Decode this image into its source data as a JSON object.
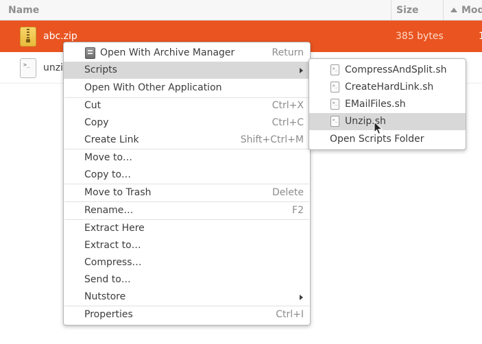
{
  "columns": {
    "name": "Name",
    "size": "Size",
    "modified": "Mod"
  },
  "files": [
    {
      "name": "abc.zip",
      "size": "385 bytes",
      "modified_partial": "1",
      "icon": "zip-archive-icon",
      "selected": true
    },
    {
      "name": "unzip",
      "size": "",
      "icon": "shell-script-icon",
      "selected": false
    }
  ],
  "context_menu": {
    "items": [
      {
        "label": "Open With Archive Manager",
        "accel": "Return",
        "icon": "archive-manager-icon"
      },
      {
        "label": "Scripts",
        "accel": "",
        "submenu": true,
        "highlighted": true
      },
      {
        "label": "Open With Other Application",
        "accel": ""
      },
      {
        "label": "Cut",
        "accel": "Ctrl+X"
      },
      {
        "label": "Copy",
        "accel": "Ctrl+C"
      },
      {
        "label": "Create Link",
        "accel": "Shift+Ctrl+M"
      },
      {
        "label": "Move to…",
        "accel": ""
      },
      {
        "label": "Copy to…",
        "accel": ""
      },
      {
        "label": "Move to Trash",
        "accel": "Delete"
      },
      {
        "label": "Rename…",
        "accel": "F2"
      },
      {
        "label": "Extract Here",
        "accel": ""
      },
      {
        "label": "Extract to…",
        "accel": ""
      },
      {
        "label": "Compress…",
        "accel": ""
      },
      {
        "label": "Send to…",
        "accel": ""
      },
      {
        "label": "Nutstore",
        "accel": "",
        "submenu": true
      },
      {
        "label": "Properties",
        "accel": "Ctrl+I"
      }
    ]
  },
  "scripts_submenu": {
    "items": [
      {
        "label": "CompressAndSplit.sh",
        "icon": "shell-script-icon"
      },
      {
        "label": "CreateHardLink.sh",
        "icon": "shell-script-icon"
      },
      {
        "label": "EMailFiles.sh",
        "icon": "shell-script-icon"
      },
      {
        "label": "Unzip.sh",
        "icon": "shell-script-icon",
        "highlighted": true
      },
      {
        "label": "Open Scripts Folder"
      }
    ]
  },
  "colors": {
    "selection": "#e95420",
    "menu_highlight": "#d8d8d8"
  }
}
